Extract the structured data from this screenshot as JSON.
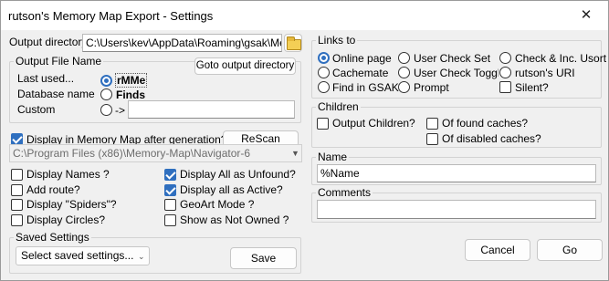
{
  "window": {
    "title": "rutson's Memory Map Export - Settings",
    "close_glyph": "✕"
  },
  "output": {
    "directory_label": "Output directory",
    "directory_value": "C:\\Users\\kev\\AppData\\Roaming\\gsak\\Mem",
    "filename_group": "Output File Name",
    "goto_button": "Goto output directory",
    "last_used_label": "Last used...",
    "last_used_value": "rMMe",
    "database_label": "Database name",
    "database_value": "Finds",
    "custom_label": "Custom",
    "custom_arrow": "->",
    "custom_value": ""
  },
  "display_mm": {
    "label": "Display in Memory Map after generation?",
    "checked": true,
    "rescan_button": "ReScan",
    "program_path": "C:\\Program Files (x86)\\Memory-Map\\Navigator-6"
  },
  "options_left": [
    {
      "label": "Display Names ?",
      "checked": false
    },
    {
      "label": "Add route?",
      "checked": false
    },
    {
      "label": "Display \"Spiders\"?",
      "checked": false
    },
    {
      "label": "Display Circles?",
      "checked": false
    }
  ],
  "options_right": [
    {
      "label": "Display All as Unfound?",
      "checked": true
    },
    {
      "label": "Display all as Active?",
      "checked": true
    },
    {
      "label": "GeoArt Mode ?",
      "checked": false
    },
    {
      "label": "Show as Not Owned ?",
      "checked": false
    }
  ],
  "saved_settings": {
    "group": "Saved Settings",
    "select_value": "Select saved settings...",
    "save_button": "Save"
  },
  "links_to": {
    "group": "Links to",
    "col1": [
      {
        "label": "Online page",
        "type": "radio",
        "checked": true
      },
      {
        "label": "Cachemate",
        "type": "radio",
        "checked": false
      },
      {
        "label": "Find in GSAK",
        "type": "radio",
        "checked": false
      }
    ],
    "col2": [
      {
        "label": "User Check Set",
        "type": "radio",
        "checked": false
      },
      {
        "label": "User Check Toggle",
        "type": "radio",
        "checked": false
      },
      {
        "label": "Prompt",
        "type": "radio",
        "checked": false
      }
    ],
    "col3": [
      {
        "label": "Check & Inc. Usort",
        "type": "radio",
        "checked": false
      },
      {
        "label": "rutson's URI",
        "type": "radio",
        "checked": false
      },
      {
        "label": "Silent?",
        "type": "checkbox",
        "checked": false
      }
    ]
  },
  "children": {
    "group": "Children",
    "output_children": "Output Children?",
    "found_caches": "Of found caches?",
    "disabled_caches": "Of disabled caches?"
  },
  "name": {
    "group": "Name",
    "value": "%Name"
  },
  "comments": {
    "group": "Comments",
    "value": ""
  },
  "footer": {
    "cancel_button": "Cancel",
    "go_button": "Go"
  },
  "colors": {
    "accent": "#2f6fbf",
    "window_bg": "#f0f0f0",
    "folder": "#f4cf55"
  }
}
